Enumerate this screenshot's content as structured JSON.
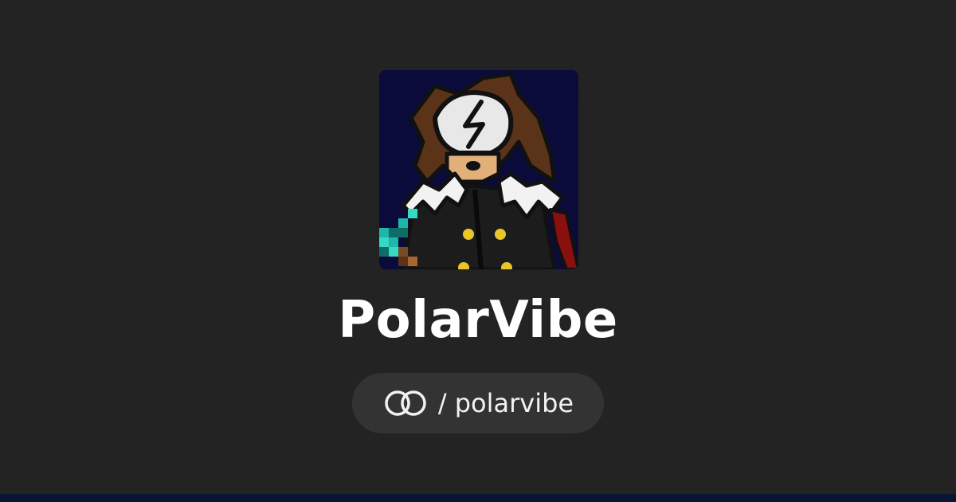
{
  "profile": {
    "name": "PolarVibe",
    "handle_separator": "/",
    "handle": "polarvibe",
    "avatar_icon": "pixel-art-character-avatar",
    "brand_icon": "interlocked-rings-logo-icon"
  },
  "colors": {
    "background": "#232323",
    "pill_background": "#333333",
    "text": "#ffffff",
    "avatar_background": "#0b0b3b",
    "bottom_bar": "#0a1433"
  }
}
